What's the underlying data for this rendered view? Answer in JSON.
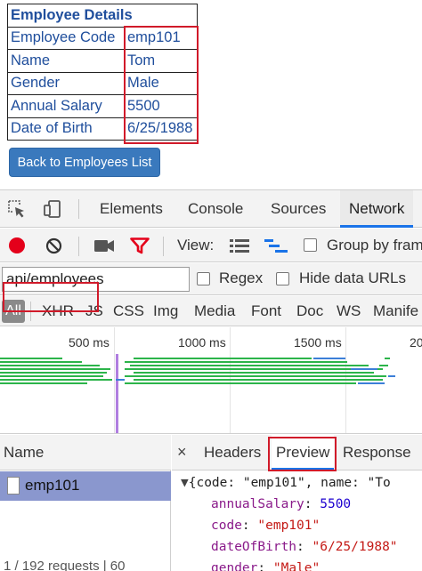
{
  "employee": {
    "title": "Employee Details",
    "rows": [
      {
        "label": "Employee Code",
        "value": "emp101"
      },
      {
        "label": "Name",
        "value": "Tom"
      },
      {
        "label": "Gender",
        "value": "Male"
      },
      {
        "label": "Annual Salary",
        "value": "5500"
      },
      {
        "label": "Date of Birth",
        "value": "6/25/1988"
      }
    ],
    "back_button": "Back to Employees List"
  },
  "devtools": {
    "tabs": [
      "Elements",
      "Console",
      "Sources",
      "Network"
    ],
    "active_tab": "Network",
    "toolbar": {
      "view_label": "View:",
      "group_by_frame": "Group by fram"
    },
    "filter": {
      "value": "api/employees",
      "regex_label": "Regex",
      "hide_data_urls_label": "Hide data URLs"
    },
    "types": [
      "All",
      "XHR",
      "JS",
      "CSS",
      "Img",
      "Media",
      "Font",
      "Doc",
      "WS",
      "Manife"
    ],
    "timeline": {
      "labels": [
        "500 ms",
        "1000 ms",
        "1500 ms",
        "20"
      ]
    },
    "name_panel": {
      "header": "Name",
      "selected_request": "emp101",
      "footer": "1 / 192 requests | 60"
    },
    "detail_panel": {
      "close": "×",
      "tabs": [
        "Headers",
        "Preview",
        "Response"
      ],
      "active_tab": "Preview",
      "preview": {
        "summary": "{code: \"emp101\", name: \"To",
        "fields": [
          {
            "key": "annualSalary",
            "value": "5500",
            "kind": "num"
          },
          {
            "key": "code",
            "value": "\"emp101\"",
            "kind": "str"
          },
          {
            "key": "dateOfBirth",
            "value": "\"6/25/1988\"",
            "kind": "str"
          },
          {
            "key": "gender",
            "value": "\"Male\"",
            "kind": "str"
          }
        ]
      }
    }
  },
  "colors": {
    "link_blue": "#1f4e9c",
    "button_blue": "#3a79bd",
    "highlight_red": "#d11a2a",
    "record_red": "#e4001a",
    "filter_red": "#e4001a",
    "selected_row": "#8a97ce",
    "active_tab_underline": "#1a73e8"
  },
  "icons": [
    "inspect-cursor-icon",
    "device-toggle-icon",
    "record-icon",
    "clear-icon",
    "camera-icon",
    "filter-icon",
    "list-view-icon",
    "waterfall-view-icon",
    "file-icon",
    "close-icon",
    "expand-triangle-icon"
  ]
}
